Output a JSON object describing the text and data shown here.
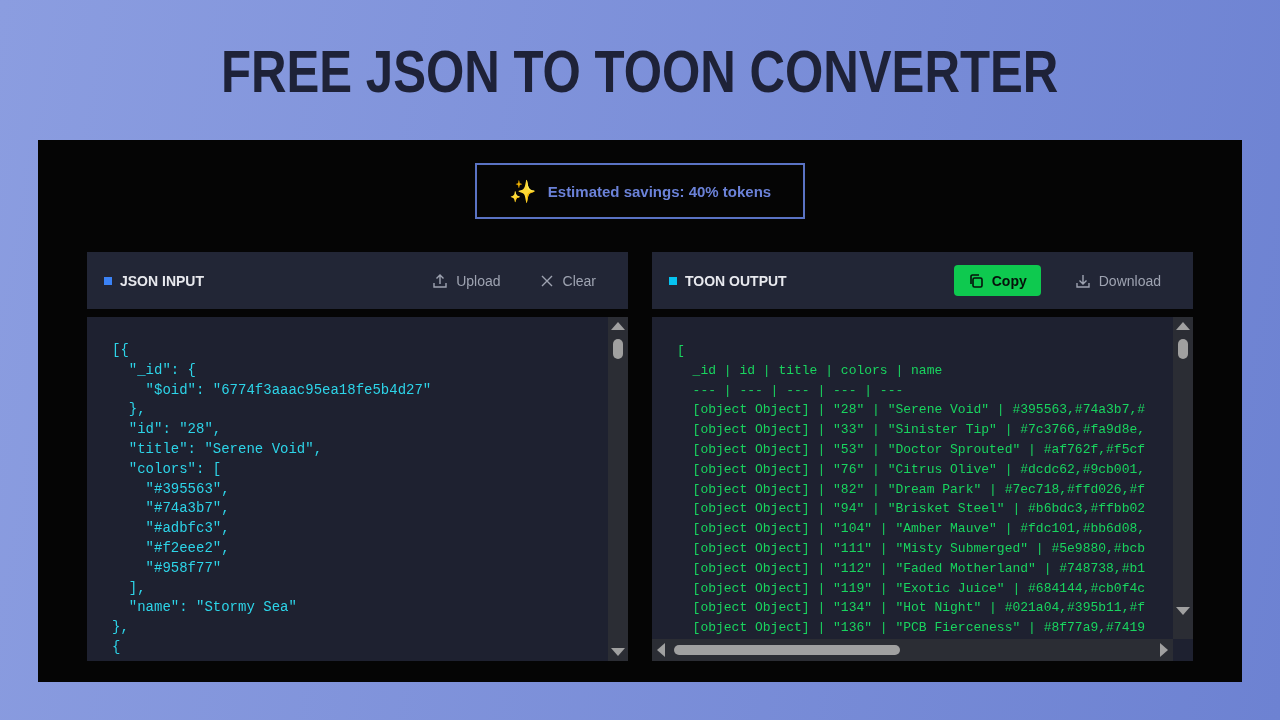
{
  "title": "FREE JSON TO TOON CONVERTER",
  "savings": {
    "icon": "✨",
    "text": "Estimated savings: 40% tokens"
  },
  "panels": [
    {
      "kind": "input",
      "title": "JSON INPUT",
      "color": "#3b82f6",
      "actions": [
        {
          "kind": "upload",
          "label": "Upload",
          "primary": false
        },
        {
          "kind": "clear",
          "label": "Clear",
          "primary": false
        }
      ],
      "lines": [
        "[{",
        "  \"_id\": {",
        "    \"$oid\": \"6774f3aaac95ea18fe5b4d27\"",
        "  },",
        "  \"id\": \"28\",",
        "  \"title\": \"Serene Void\",",
        "  \"colors\": [",
        "    \"#395563\",",
        "    \"#74a3b7\",",
        "    \"#adbfc3\",",
        "    \"#f2eee2\",",
        "    \"#958f77\"",
        "  ],",
        "  \"name\": \"Stormy Sea\"",
        "},",
        "{"
      ]
    },
    {
      "kind": "output",
      "title": "TOON OUTPUT",
      "color": "#06c3f0",
      "actions": [
        {
          "kind": "copy",
          "label": "Copy",
          "primary": true
        },
        {
          "kind": "download",
          "label": "Download",
          "primary": false
        }
      ],
      "lines": [
        "[",
        "  _id | id | title | colors | name",
        "  --- | --- | --- | --- | ---",
        "  [object Object] | \"28\" | \"Serene Void\" | #395563,#74a3b7,#",
        "  [object Object] | \"33\" | \"Sinister Tip\" | #7c3766,#fa9d8e,",
        "  [object Object] | \"53\" | \"Doctor Sprouted\" | #af762f,#f5cf",
        "  [object Object] | \"76\" | \"Citrus Olive\" | #dcdc62,#9cb001,",
        "  [object Object] | \"82\" | \"Dream Park\" | #7ec718,#ffd026,#f",
        "  [object Object] | \"94\" | \"Brisket Steel\" | #b6bdc3,#ffbb02",
        "  [object Object] | \"104\" | \"Amber Mauve\" | #fdc101,#bb6d08,",
        "  [object Object] | \"111\" | \"Misty Submerged\" | #5e9880,#bcb",
        "  [object Object] | \"112\" | \"Faded Motherland\" | #748738,#b1",
        "  [object Object] | \"119\" | \"Exotic Juice\" | #684144,#cb0f4c",
        "  [object Object] | \"134\" | \"Hot Night\" | #021a04,#395b11,#f",
        "  [object Object] | \"136\" | \"PCB Fierceness\" | #8f77a9,#7419"
      ]
    }
  ]
}
